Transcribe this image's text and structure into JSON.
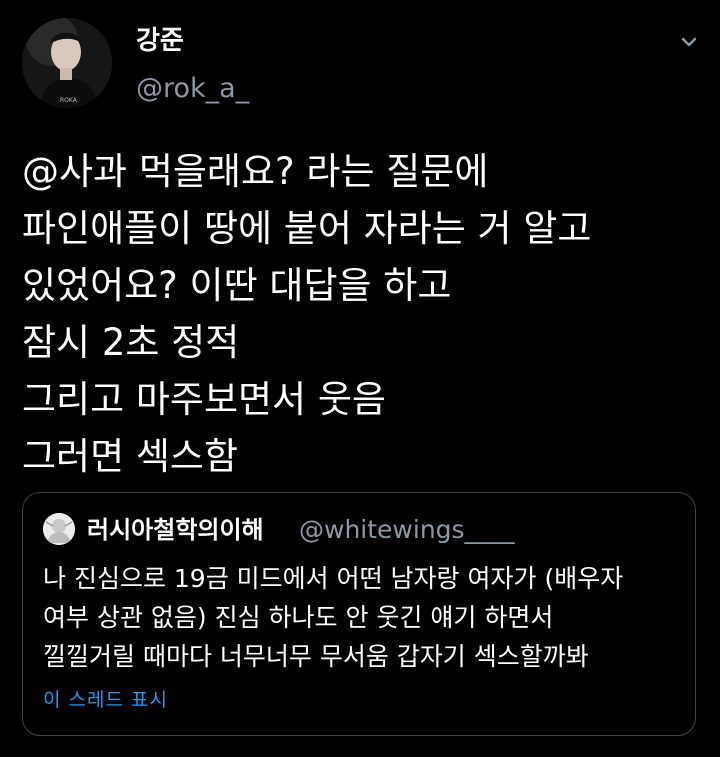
{
  "tweet": {
    "author": {
      "display_name": "강준",
      "handle": "@rok_a_"
    },
    "menu_icon": "chevron-down-icon",
    "body_lines": [
      "@사과 먹을래요? 라는 질문에",
      "파인애플이 땅에 붙어 자라는 거 알고",
      "있었어요? 이딴 대답을 하고",
      "잠시 2초 정적",
      "그리고 마주보면서 웃음",
      "그러면 섹스함"
    ],
    "quote": {
      "display_name": "러시아철학의이해",
      "handle": "@whitewings____",
      "text_lines": [
        "나 진심으로 19금 미드에서 어떤 남자랑 여자가 (배우자",
        "여부 상관 없음) 진심 하나도 안 웃긴 얘기 하면서",
        "낄낄거릴 때마다 너무너무 무서움 갑자기 섹스할까봐"
      ],
      "show_thread": "이 스레드 표시"
    }
  },
  "colors": {
    "background": "#000000",
    "text": "#ffffff",
    "secondary": "#8b98a5",
    "link": "#1d9bf0",
    "border": "#3d4249"
  }
}
